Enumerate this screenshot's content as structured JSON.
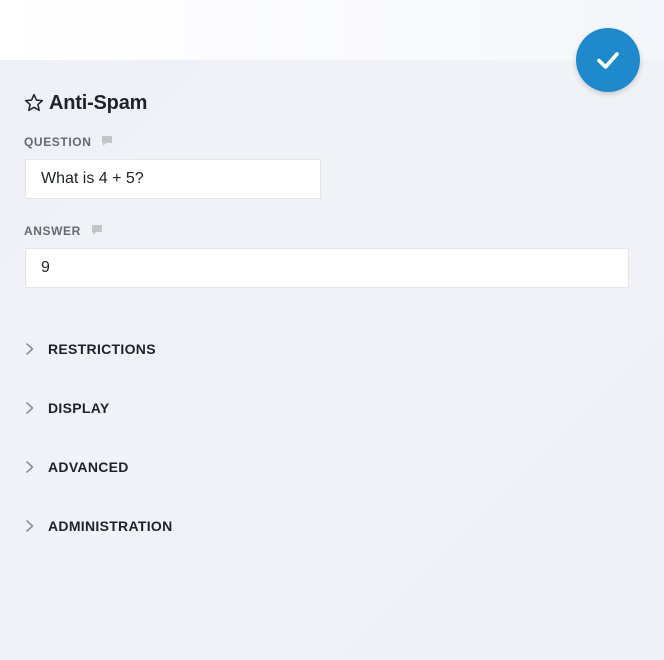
{
  "panel": {
    "title": "Anti-Spam"
  },
  "fields": {
    "question": {
      "label": "QUESTION",
      "value": "What is 4 + 5?"
    },
    "answer": {
      "label": "ANSWER",
      "value": "9"
    }
  },
  "sections": [
    {
      "label": "RESTRICTIONS"
    },
    {
      "label": "DISPLAY"
    },
    {
      "label": "ADVANCED"
    },
    {
      "label": "ADMINISTRATION"
    }
  ],
  "colors": {
    "accent": "#1e8acb",
    "text": "#1d2327",
    "label": "#646970",
    "icon_muted": "#c3c4c7"
  },
  "icons": {
    "confirm": "check-icon",
    "title": "star-outline-icon",
    "field_hint": "comment-icon",
    "section_toggle": "chevron-right-icon"
  }
}
